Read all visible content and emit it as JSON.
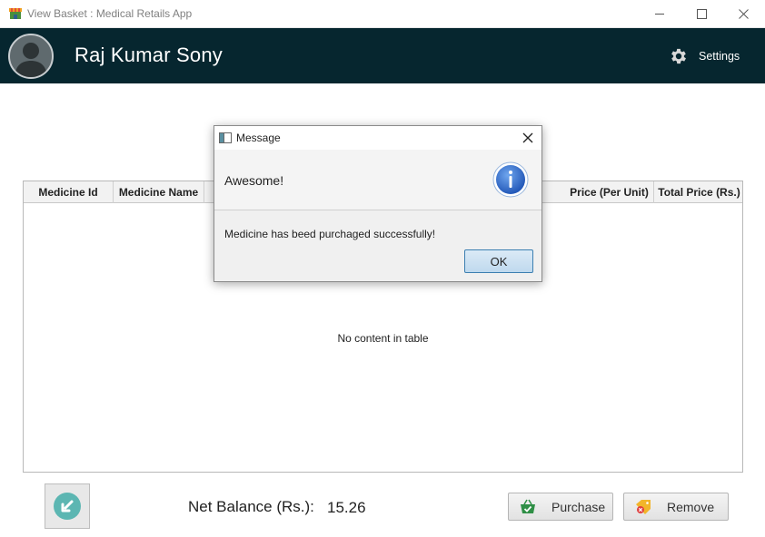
{
  "window": {
    "title": "View Basket : Medical Retails App",
    "controls": [
      "minimize",
      "maximize",
      "close"
    ]
  },
  "header": {
    "user_name": "Raj Kumar Sony",
    "settings_label": "Settings",
    "background": "#06262f"
  },
  "table": {
    "columns": [
      "Medicine Id",
      "Medicine Name",
      "Price (Per Unit)",
      "Total Price (Rs.)"
    ],
    "rows": [],
    "empty_message": "No content in table"
  },
  "footer": {
    "back_icon": "back-arrow-icon",
    "balance_label": "Net Balance (Rs.):",
    "balance_value": "15.26",
    "purchase_label": "Purchase",
    "remove_label": "Remove"
  },
  "dialog": {
    "title": "Message",
    "heading": "Awesome!",
    "message": "Medicine has beed purchaged successfully!",
    "ok_label": "OK",
    "icon": "info-icon",
    "accent": "#3a78c9"
  }
}
